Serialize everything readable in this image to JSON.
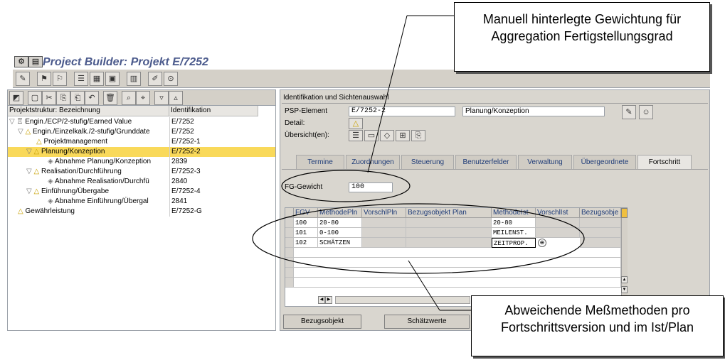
{
  "app": {
    "title": "Project Builder: Projekt E/7252"
  },
  "left": {
    "col_name": "Projektstruktur: Bezeichnung",
    "col_id": "Identifikation",
    "rows": [
      {
        "name": "Engin./ECP/2-stufig/Earned Value",
        "id": "E/7252"
      },
      {
        "name": "Engin./Einzelkalk./2-stufig/Grunddate",
        "id": "E/7252"
      },
      {
        "name": "Projektmanagement",
        "id": "E/7252-1"
      },
      {
        "name": "Planung/Konzeption",
        "id": "E/7252-2"
      },
      {
        "name": "Abnahme Planung/Konzeption",
        "id": "2839"
      },
      {
        "name": "Realisation/Durchführung",
        "id": "E/7252-3"
      },
      {
        "name": "Abnahme Realisation/Durchfü",
        "id": "2840"
      },
      {
        "name": "Einführung/Übergabe",
        "id": "E/7252-4"
      },
      {
        "name": "Abnahme Einführung/Übergal",
        "id": "2841"
      },
      {
        "name": "Gewährleistung",
        "id": "E/7252-G"
      }
    ]
  },
  "right": {
    "section_title": "Identifikation und Sichtenauswahl",
    "psp_label": "PSP-Element",
    "psp_value": "E/7252-2",
    "psp_desc": "Planung/Konzeption",
    "detail_label": "Detail:",
    "overview_label": "Übersicht(en):",
    "tabs": [
      "Termine",
      "Zuordnungen",
      "Steuerung",
      "Benutzerfelder",
      "Verwaltung",
      "Übergeordnete",
      "Fortschritt"
    ],
    "fg_label": "FG-Gewicht",
    "fg_value": "100",
    "grid": {
      "headers": [
        "FGV",
        "MethodePln",
        "VorschlPln",
        "Bezugsobjekt Plan",
        "MethodeIst",
        "VorschlIst",
        "Bezugsobje"
      ],
      "rows": [
        [
          "100",
          "20-80",
          "",
          "",
          "20-80",
          "",
          ""
        ],
        [
          "101",
          "0-100",
          "",
          "",
          "MEILENST.",
          "",
          ""
        ],
        [
          "102",
          "SCHÄTZEN",
          "",
          "",
          "ZEITPROP.",
          "",
          ""
        ]
      ]
    },
    "buttons": {
      "bezugsobjekt": "Bezugsobjekt",
      "schaetzwerte": "Schätzwerte"
    }
  },
  "callouts": {
    "top": "Manuell hinterlegte Gewichtung für Aggregation Fertigstellungsgrad",
    "bottom": "Abweichende Meßmethoden pro Fortschrittsversion und im Ist/Plan"
  }
}
